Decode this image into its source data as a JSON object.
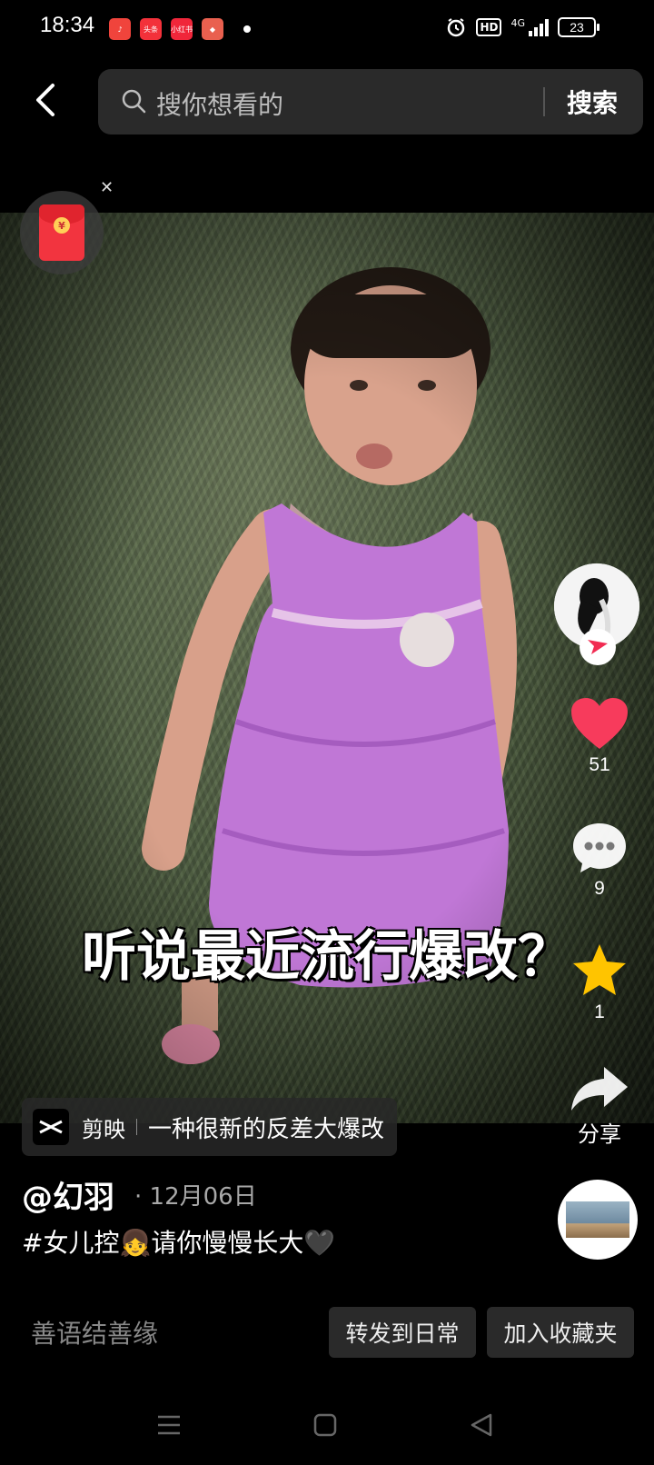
{
  "status": {
    "time": "18:34",
    "apps": [
      {
        "name": "music-app-icon",
        "label": "♪",
        "color": "#f0443c"
      },
      {
        "name": "toutiao-app-icon",
        "label": "头条",
        "color": "#f3313a"
      },
      {
        "name": "xiaohongshu-app-icon",
        "label": "小红书",
        "color": "#f0263a"
      },
      {
        "name": "shortcut-app-icon",
        "label": "◆",
        "color": "#e9604f"
      }
    ],
    "hd": "HD",
    "network": "4G",
    "battery": "23"
  },
  "search": {
    "placeholder": "搜你想看的",
    "button": "搜索"
  },
  "video": {
    "caption": "听说最近流行爆改？",
    "template_app": "剪映",
    "template_text": "一种很新的反差大爆改"
  },
  "actions": {
    "likes": "51",
    "comments": "9",
    "favorites": "1",
    "share": "分享"
  },
  "post": {
    "author": "@幻羽",
    "date": "· 12月06日",
    "description": "#女儿控👧请你慢慢长大🖤"
  },
  "footer": {
    "comment_hint": "善语结善缘",
    "repost": "转发到日常",
    "collect": "加入收藏夹"
  }
}
